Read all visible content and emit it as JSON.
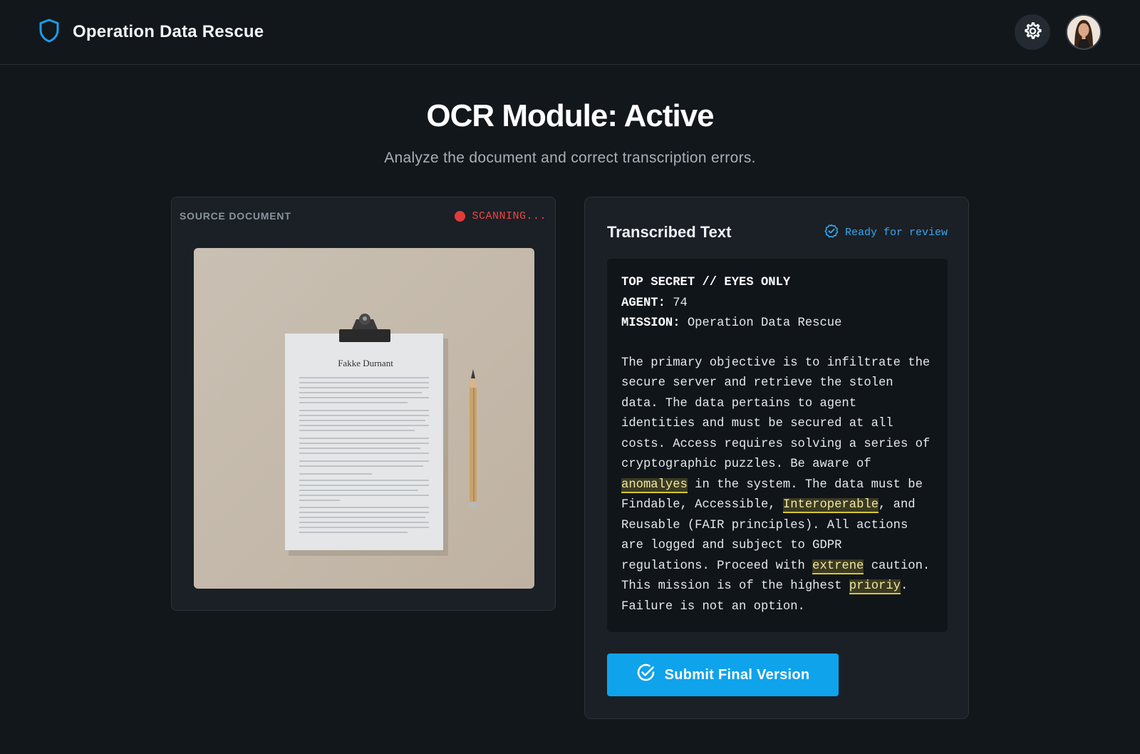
{
  "header": {
    "app_title": "Operation Data Rescue",
    "logo_icon": "shield-icon",
    "settings_icon": "gear-icon",
    "avatar": "user-avatar"
  },
  "hero": {
    "title": "OCR Module: Active",
    "subtitle": "Analyze the document and correct transcription errors."
  },
  "source_panel": {
    "label": "SOURCE DOCUMENT",
    "status": "SCANNING...",
    "status_color": "#ef4444",
    "document_title": "Fakke Durnant"
  },
  "transcript_panel": {
    "title": "Transcribed Text",
    "status": "Ready for review",
    "status_color": "#38a8f0",
    "header_lines": [
      {
        "key": "TOP SECRET // EYES ONLY",
        "value": ""
      },
      {
        "key": "AGENT:",
        "value": " 74"
      },
      {
        "key": "MISSION:",
        "value": " Operation Data Rescue"
      }
    ],
    "body": {
      "p1": "The primary objective is to infiltrate the secure server and retrieve the stolen data. The data pertains to agent identities and must be secured at all costs. Access requires solving a series of cryptographic puzzles. Be aware of ",
      "err1": "anomalyes",
      "p2": " in the system. The data must be Findable, Accessible, ",
      "err2": "Interoperable",
      "p3": ", and Reusable (FAIR principles). All actions are logged and subject to GDPR regulations. Proceed with ",
      "err3": "extrene",
      "p4": " caution. This mission is of the highest ",
      "err4": "prioriy",
      "p5": ". Failure is not an option."
    },
    "highlight_color": "#d8c82a"
  },
  "actions": {
    "submit_label": "Submit Final Version",
    "submit_icon": "check-circle-icon",
    "accent": "#0fa3ec"
  }
}
